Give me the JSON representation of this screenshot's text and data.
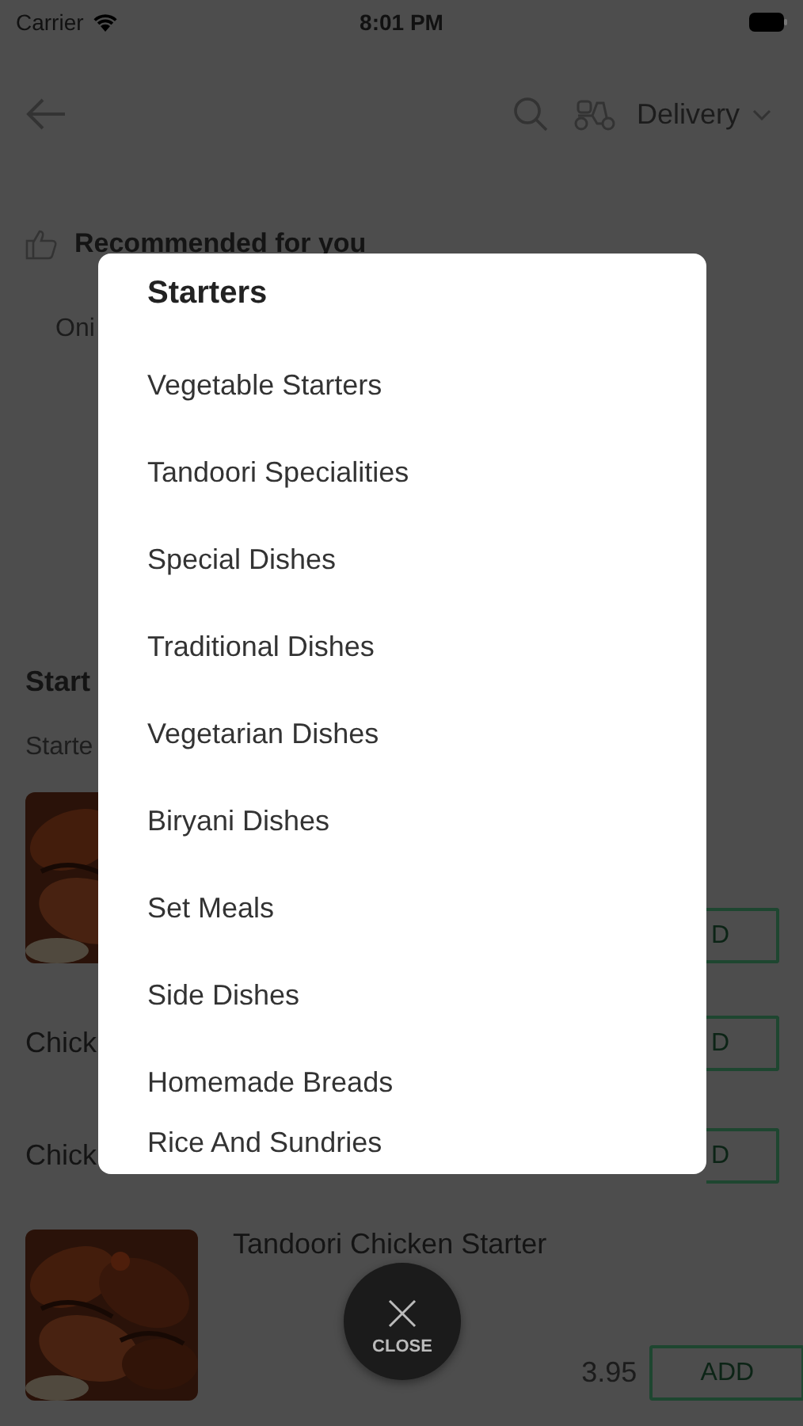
{
  "status_bar": {
    "carrier": "Carrier",
    "time": "8:01 PM"
  },
  "header": {
    "delivery_mode": "Delivery"
  },
  "recommended": {
    "title": "Recommended for you",
    "items": [
      {
        "name": "Oni"
      }
    ]
  },
  "section": {
    "title": "Start",
    "subtitle": "Starte"
  },
  "dishes": [
    {
      "picture": true,
      "button": "D",
      "partial": true
    },
    {
      "picture": false,
      "name": "Chick",
      "button": "D",
      "partial": true
    },
    {
      "picture": false,
      "name": "Chick",
      "button": "D",
      "partial": true
    },
    {
      "picture": true,
      "name": "Tandoori Chicken Starter",
      "price": "3.95",
      "button": "ADD",
      "partial": false
    }
  ],
  "menu": {
    "title": "Starters",
    "items": [
      "Vegetable Starters",
      "Tandoori Specialities",
      "Special Dishes",
      "Traditional Dishes",
      "Vegetarian Dishes",
      "Biryani Dishes",
      "Set Meals",
      "Side Dishes",
      "Homemade Breads",
      "Rice And Sundries"
    ]
  },
  "close_button": {
    "label": "CLOSE"
  }
}
